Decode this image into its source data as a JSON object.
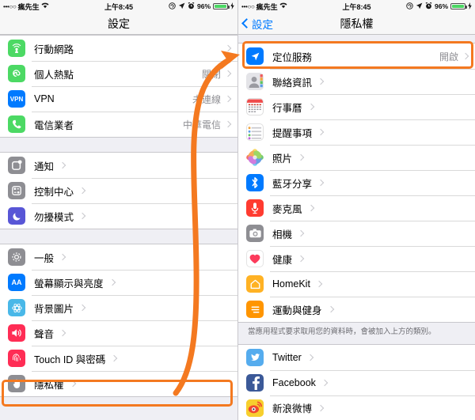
{
  "status_bar": {
    "signal_dots": "•••○○",
    "carrier": "瘋先生",
    "wifi_icon": "wifi-icon",
    "time": "上午8:45",
    "rotation_lock_icon": "rotation-lock-icon",
    "location_icon": "location-arrow-icon",
    "alarm_icon": "alarm-clock-icon",
    "battery_percent": "96%",
    "charging_icon": "charging-bolt-icon"
  },
  "left_panel": {
    "nav": {
      "title": "設定"
    },
    "groups": [
      {
        "rows": [
          {
            "icon": "cellular-icon",
            "label": "行動網路",
            "value": "",
            "color": "#4cd964"
          },
          {
            "icon": "personal-hotspot-icon",
            "label": "個人熱點",
            "value": "關閉",
            "color": "#4cd964"
          },
          {
            "icon": "vpn-icon",
            "label": "VPN",
            "value": "未連線",
            "color": "#007aff"
          },
          {
            "icon": "carrier-phone-icon",
            "label": "電信業者",
            "value": "中華電信",
            "color": "#4cd964"
          }
        ]
      },
      {
        "rows": [
          {
            "icon": "notifications-icon",
            "label": "通知",
            "value": "",
            "color": "#8e8e93"
          },
          {
            "icon": "control-center-icon",
            "label": "控制中心",
            "value": "",
            "color": "#8e8e93"
          },
          {
            "icon": "do-not-disturb-icon",
            "label": "勿擾模式",
            "value": "",
            "color": "#5856d6"
          }
        ]
      },
      {
        "rows": [
          {
            "icon": "general-gear-icon",
            "label": "一般",
            "value": "",
            "color": "#8e8e93"
          },
          {
            "icon": "display-text-icon",
            "label": "螢幕顯示與亮度",
            "value": "",
            "color": "#007aff"
          },
          {
            "icon": "wallpaper-icon",
            "label": "背景圖片",
            "value": "",
            "color": "#49b8e8"
          },
          {
            "icon": "sounds-icon",
            "label": "聲音",
            "value": "",
            "color": "#ff2d55"
          },
          {
            "icon": "touch-id-icon",
            "label": "Touch ID 與密碼",
            "value": "",
            "color": "#ff2d55"
          },
          {
            "icon": "privacy-hand-icon",
            "label": "隱私權",
            "value": "",
            "color": "#8e8e93"
          }
        ]
      }
    ]
  },
  "right_panel": {
    "nav": {
      "back_label": "設定",
      "title": "隱私權"
    },
    "groups": [
      {
        "rows": [
          {
            "icon": "location-services-icon",
            "label": "定位服務",
            "value": "開啟",
            "color": "#007aff"
          },
          {
            "icon": "contacts-icon",
            "label": "聯絡資訊",
            "value": "",
            "color": "#b0b0b5"
          },
          {
            "icon": "calendar-icon",
            "label": "行事曆",
            "value": "",
            "color": "#ffffff"
          },
          {
            "icon": "reminders-icon",
            "label": "提醒事項",
            "value": "",
            "color": "#ffffff"
          },
          {
            "icon": "photos-icon",
            "label": "照片",
            "value": "",
            "color": "#ffffff"
          },
          {
            "icon": "bluetooth-icon",
            "label": "藍牙分享",
            "value": "",
            "color": "#007aff"
          },
          {
            "icon": "microphone-icon",
            "label": "麥克風",
            "value": "",
            "color": "#ff3b30"
          },
          {
            "icon": "camera-icon",
            "label": "相機",
            "value": "",
            "color": "#8e8e93"
          },
          {
            "icon": "health-icon",
            "label": "健康",
            "value": "",
            "color": "#ffffff"
          },
          {
            "icon": "homekit-icon",
            "label": "HomeKit",
            "value": "",
            "color": "#ffb224"
          },
          {
            "icon": "motion-fitness-icon",
            "label": "運動與健身",
            "value": "",
            "color": "#ff9500"
          }
        ]
      },
      {
        "rows": [
          {
            "icon": "twitter-icon",
            "label": "Twitter",
            "value": "",
            "color": "#55acee"
          },
          {
            "icon": "facebook-icon",
            "label": "Facebook",
            "value": "",
            "color": "#3b5998"
          },
          {
            "icon": "weibo-icon",
            "label": "新浪微博",
            "value": "",
            "color": "#e6162d"
          }
        ]
      }
    ],
    "footnote": "當應用程式要求取用您的資料時，會被加入上方的類別。"
  },
  "annotation": {
    "highlight_color": "#f47920",
    "arrow_name": "orange-curved-arrow",
    "highlighted_left_row": "隱私權",
    "highlighted_right_row": "定位服務"
  }
}
